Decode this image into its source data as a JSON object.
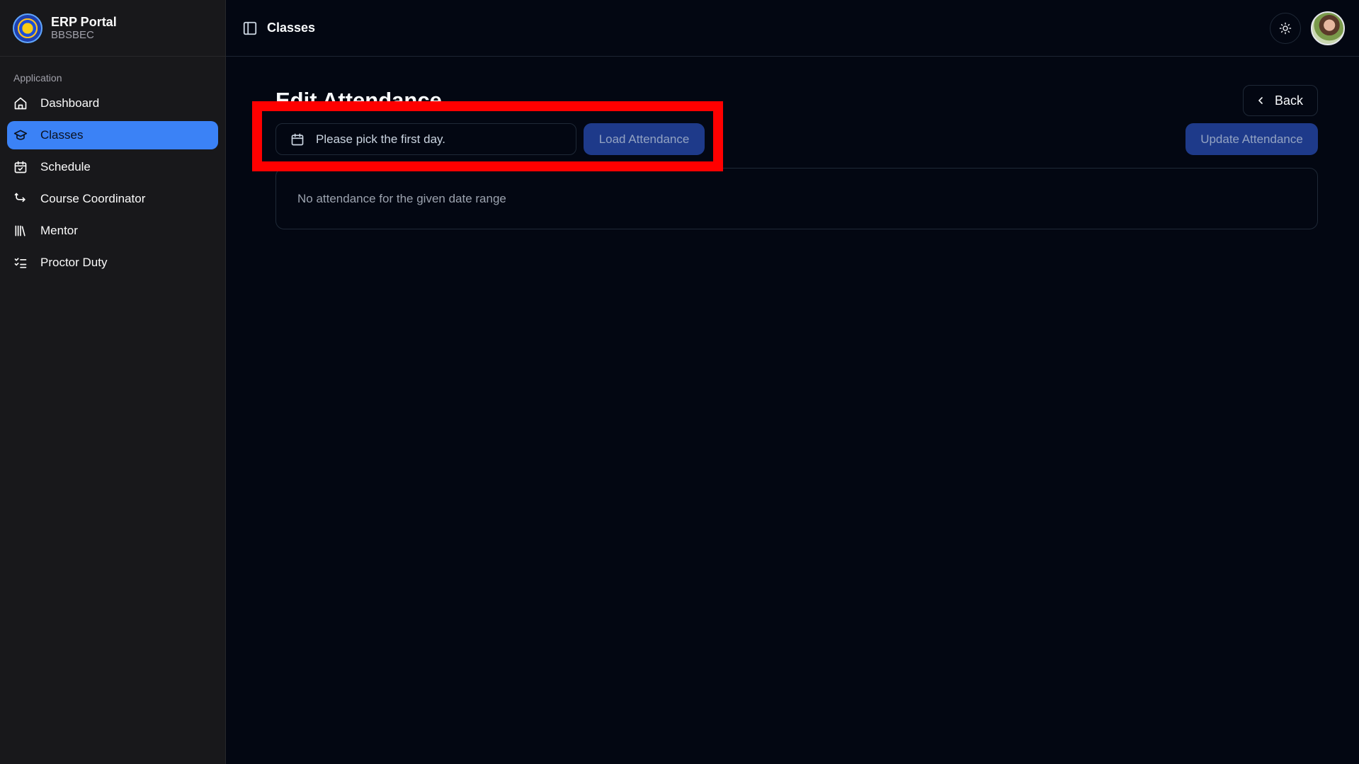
{
  "brand": {
    "title": "ERP Portal",
    "subtitle": "BBSBEC"
  },
  "sidebar": {
    "group_label": "Application",
    "items": [
      {
        "label": "Dashboard",
        "icon": "home-icon",
        "active": false
      },
      {
        "label": "Classes",
        "icon": "graduation-cap-icon",
        "active": true
      },
      {
        "label": "Schedule",
        "icon": "calendar-check-icon",
        "active": false
      },
      {
        "label": "Course Coordinator",
        "icon": "route-icon",
        "active": false
      },
      {
        "label": "Mentor",
        "icon": "library-icon",
        "active": false
      },
      {
        "label": "Proctor Duty",
        "icon": "list-checks-icon",
        "active": false
      }
    ]
  },
  "topbar": {
    "title": "Classes"
  },
  "page": {
    "title": "Edit Attendance",
    "back_label": "Back",
    "date_placeholder": "Please pick the first day.",
    "load_label": "Load Attendance",
    "update_label": "Update Attendance",
    "empty_message": "No attendance for the given date range"
  },
  "colors": {
    "background": "#030712",
    "sidebar": "#18181b",
    "active_nav": "#3b82f6",
    "button": "#1e3a8a",
    "highlight": "#ff0000"
  }
}
